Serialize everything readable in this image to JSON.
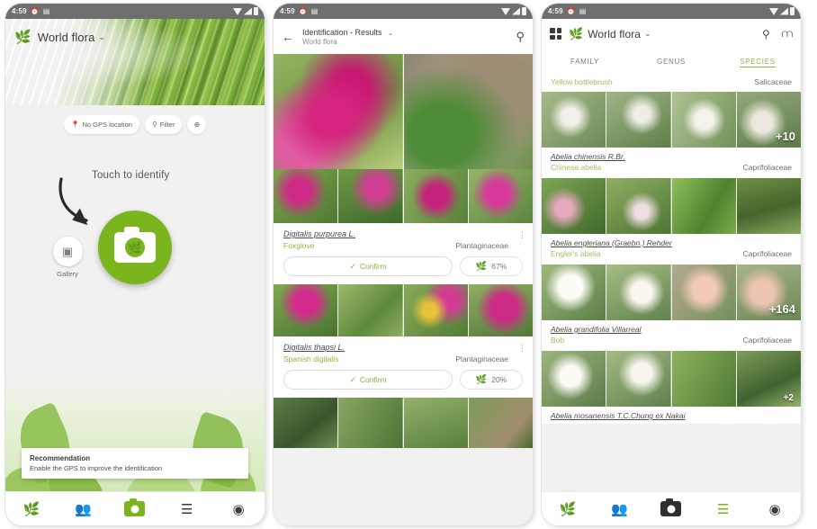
{
  "statusbar": {
    "time": "4:59",
    "icons": [
      "alarm-icon",
      "cast-icon"
    ]
  },
  "screen1": {
    "app_title": "World flora",
    "caret": "⌄",
    "chips": [
      {
        "icon": "📍",
        "label": "No GPS location",
        "name": "chip-no-gps"
      },
      {
        "icon": "⚲",
        "label": "Filter",
        "name": "chip-filter"
      },
      {
        "icon": "⊕",
        "label": "",
        "name": "chip-globe"
      }
    ],
    "touch_label": "Touch to identify",
    "gallery_label": "Gallery",
    "toast": {
      "title": "Recommendation",
      "subtitle": "Enable the GPS to improve the identification"
    },
    "nav": [
      {
        "icon": "🌿",
        "name": "nav-flora"
      },
      {
        "icon": "👥",
        "name": "nav-community"
      },
      {
        "icon": "camera",
        "name": "nav-camera",
        "active": true
      },
      {
        "icon": "☰",
        "name": "nav-list"
      },
      {
        "icon": "◉",
        "name": "nav-profile"
      }
    ]
  },
  "screen2": {
    "title": "Identification - Results",
    "subtitle": "World flora",
    "caret": "⌄",
    "back_icon": "←",
    "filter_icon": "⚲",
    "results": [
      {
        "scientific": "Digitalis purpurea L.",
        "common": "Foxglove",
        "family": "Plantaginaceae",
        "confirm_label": "Confirm",
        "score": "67%"
      },
      {
        "scientific": "Digitalis thapsi L.",
        "common": "Spanish digitalis",
        "family": "Plantaginaceae",
        "confirm_label": "Confirm",
        "score": "20%"
      }
    ],
    "nav": [
      {
        "icon": "🌿",
        "name": "nav-flora"
      },
      {
        "icon": "👥",
        "name": "nav-community"
      },
      {
        "icon": "camera",
        "name": "nav-camera"
      },
      {
        "icon": "☰",
        "name": "nav-list"
      },
      {
        "icon": "◉",
        "name": "nav-profile"
      }
    ]
  },
  "screen3": {
    "app_title": "World flora",
    "caret": "⌄",
    "search_icon": "⚲",
    "filter_icon": "⚲",
    "tabs": [
      {
        "label": "FAMILY",
        "active": false
      },
      {
        "label": "GENUS",
        "active": false
      },
      {
        "label": "SPECIES",
        "active": true
      }
    ],
    "header_row": {
      "common": "Yellow bottlebrush",
      "family": "Salicaceae"
    },
    "species": [
      {
        "scientific": "Abelia chinensis R.Br.",
        "common": "Chinese abelia",
        "family": "Caprifoliaceae",
        "badge": "+10"
      },
      {
        "scientific": "Abelia engleriana (Graebn.) Rehder",
        "common": "Engler's abelia",
        "family": "Caprifoliaceae",
        "badge": ""
      },
      {
        "scientific": "Abelia grandifolia Villarreal",
        "common": "Bob",
        "family": "Caprifoliaceae",
        "badge": "+164"
      },
      {
        "scientific": "Abelia mosanensis T.C.Chung ex Nakai",
        "common": "",
        "family": "",
        "badge": "+2"
      }
    ],
    "nav": [
      {
        "icon": "🌿",
        "name": "nav-flora"
      },
      {
        "icon": "👥",
        "name": "nav-community"
      },
      {
        "icon": "camera",
        "name": "nav-camera"
      },
      {
        "icon": "☰",
        "name": "nav-list",
        "active": true
      },
      {
        "icon": "◉",
        "name": "nav-profile"
      }
    ]
  },
  "colors": {
    "brand_green": "#7ab51d",
    "accent_green": "#8cb93f",
    "statusbar": "#6e6e6e",
    "page_bg": "#f1f1f1"
  }
}
